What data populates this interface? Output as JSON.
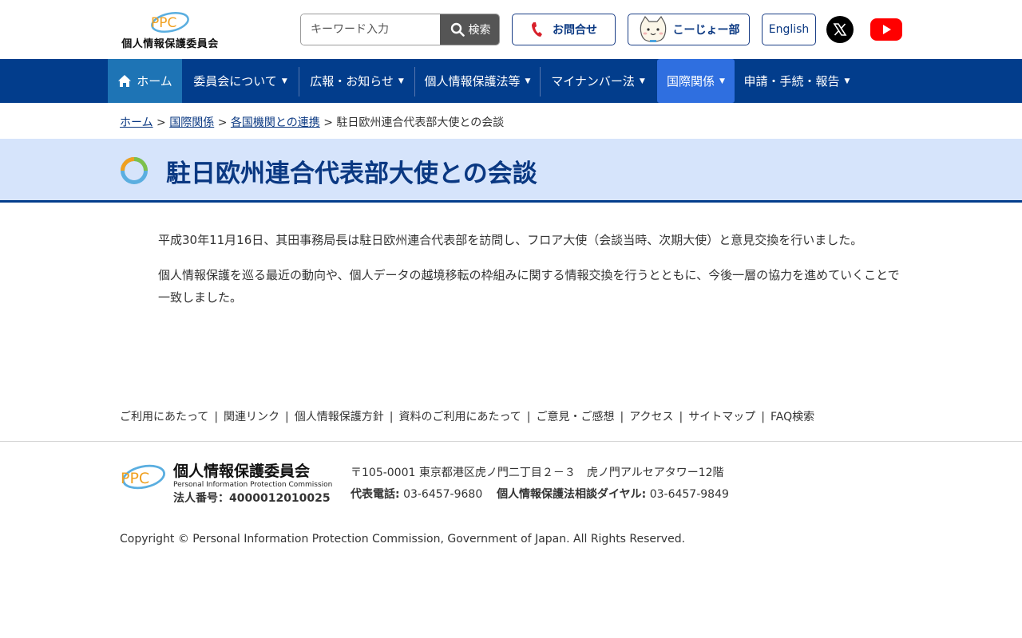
{
  "header": {
    "logo_mark_text": "PPC",
    "logo_name": "個人情報保護委員会",
    "search": {
      "placeholder": "キーワード入力",
      "button_label": "検索"
    },
    "contact_label": "お問合せ",
    "kojo_label": "こーじょー部",
    "english_label": "English"
  },
  "nav": {
    "items": [
      {
        "label": "ホーム"
      },
      {
        "label": "委員会について"
      },
      {
        "label": "広報・お知らせ"
      },
      {
        "label": "個人情報保護法等"
      },
      {
        "label": "マイナンバー法"
      },
      {
        "label": "国際関係"
      },
      {
        "label": "申請・手続・報告"
      }
    ],
    "active": "国際関係"
  },
  "breadcrumb": {
    "items": [
      "ホーム",
      "国際関係",
      "各国機関との連携"
    ],
    "current": "駐日欧州連合代表部大使との会談",
    "separator": ">"
  },
  "page": {
    "title": "駐日欧州連合代表部大使との会談",
    "paragraphs": [
      "平成30年11月16日、其田事務局長は駐日欧州連合代表部を訪問し、フロア大使（会談当時、次期大使）と意見交換を行いました。",
      "個人情報保護を巡る最近の動向や、個人データの越境移転の枠組みに関する情報交換を行うとともに、今後一層の協力を進めていくことで一致しました。"
    ]
  },
  "footer": {
    "links": [
      "ご利用にあたって",
      "関連リンク",
      "個人情報保護方針",
      "資料のご利用にあたって",
      "ご意見・ご感想",
      "アクセス",
      "サイトマップ",
      "FAQ検索"
    ],
    "link_separator": "|",
    "org_name": "個人情報保護委員会",
    "org_name_en": "Personal Information Protection Commission",
    "corporate_number": "法人番号：4000012010025",
    "address": "〒105-0001 東京都港区虎ノ門二丁目２－３　虎ノ門アルセアタワー12階",
    "phone_label": "代表電話:",
    "phone": "03-6457-9680",
    "hotline_label": "個人情報保護法相談ダイヤル:",
    "hotline": "03-6457-9849",
    "copyright": "Copyright © Personal Information Protection Commission, Government of Japan. All Rights Reserved."
  },
  "colors": {
    "nav_bg": "#023d8c",
    "nav_home": "#1e74b5",
    "nav_active": "#2f6fe0",
    "title_band": "#d6e4fb",
    "link": "#0a3882"
  },
  "icons": [
    "ppc-logo",
    "home-icon",
    "search-icon",
    "phone-icon",
    "cat-icon",
    "x-icon",
    "youtube-icon",
    "title-ring-icon"
  ]
}
